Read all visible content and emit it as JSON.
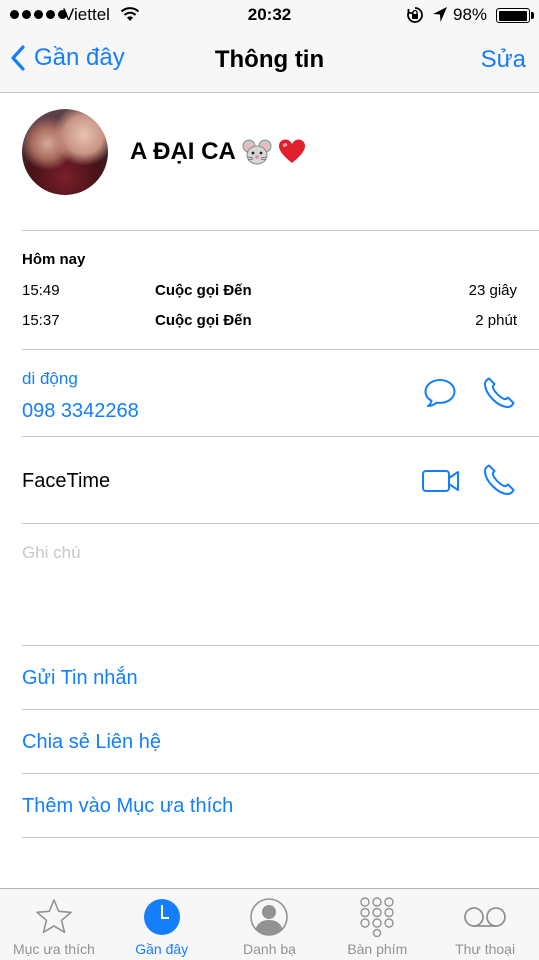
{
  "status_bar": {
    "carrier": "Viettel",
    "time": "20:32",
    "battery": "98%",
    "battery_level": 0.98
  },
  "nav": {
    "back_label": "Gần đây",
    "title": "Thông tin",
    "edit_label": "Sửa"
  },
  "contact": {
    "name": "A ĐẠI CA"
  },
  "calls": {
    "date": "Hôm nay",
    "entries": [
      {
        "time": "15:49",
        "type": "Cuộc gọi Đến",
        "duration": "23 giây"
      },
      {
        "time": "15:37",
        "type": "Cuộc gọi Đến",
        "duration": "2 phút"
      }
    ]
  },
  "phone": {
    "label": "di động",
    "number": "098 3342268"
  },
  "facetime": {
    "label": "FaceTime"
  },
  "notes": {
    "placeholder": "Ghi chú"
  },
  "actions": {
    "send_message": "Gửi Tin nhắn",
    "share_contact": "Chia sẻ Liên hệ",
    "add_favorite": "Thêm vào Mục ưa thích"
  },
  "tabs": [
    {
      "label": "Mục ưa thích",
      "icon": "star-icon",
      "active": false
    },
    {
      "label": "Gần đây",
      "icon": "clock-icon",
      "active": true
    },
    {
      "label": "Danh bạ",
      "icon": "contacts-icon",
      "active": false
    },
    {
      "label": "Bàn phím",
      "icon": "keypad-icon",
      "active": false
    },
    {
      "label": "Thư thoại",
      "icon": "voicemail-icon",
      "active": false
    }
  ],
  "colors": {
    "accent": "#157efb",
    "tab_inactive": "#929292",
    "bar_background": "#f7f7f7",
    "separator": "#c8c7cc",
    "placeholder": "#c7c7cd"
  }
}
